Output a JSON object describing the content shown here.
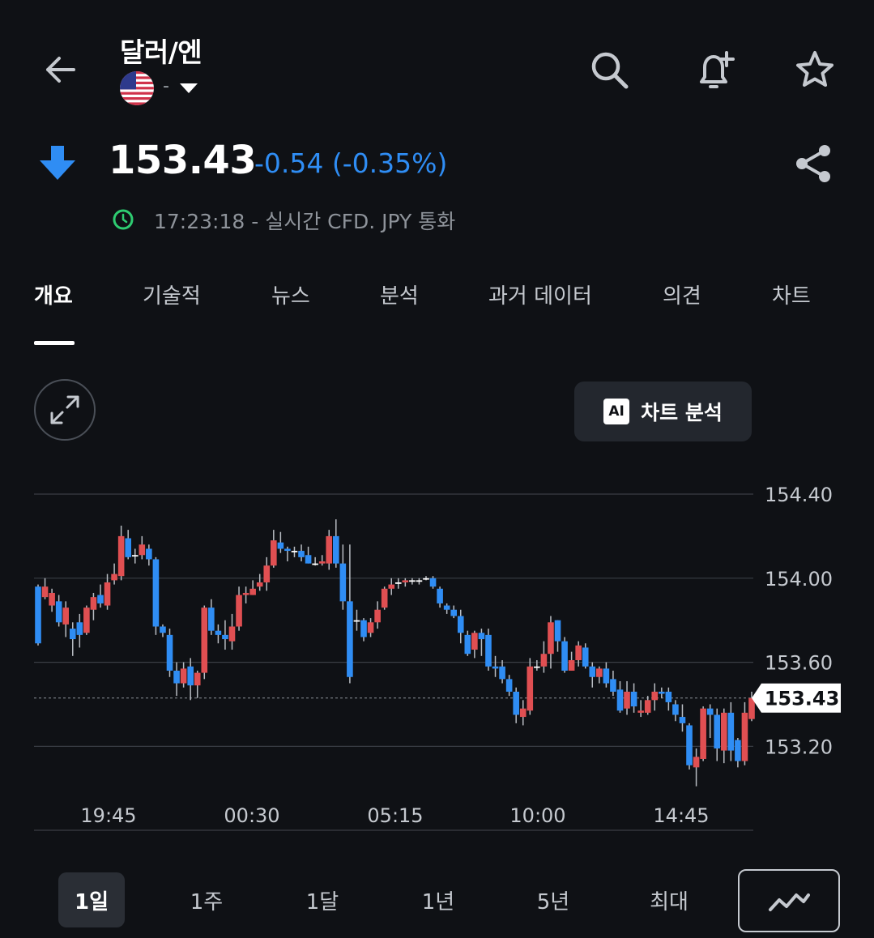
{
  "header": {
    "title": "달러/엔",
    "subtitle": "-",
    "back_icon": "arrow-left-icon",
    "search_icon": "search-icon",
    "alert_icon": "bell-plus-icon",
    "favorite_icon": "star-icon"
  },
  "quote": {
    "direction_icon": "arrow-down-icon",
    "price": "153.43",
    "change": "-0.54 (-0.35%)",
    "time_info": "17:23:18 - 실시간 CFD. JPY 통화",
    "share_icon": "share-icon"
  },
  "tabs": [
    {
      "label": "개요",
      "active": true
    },
    {
      "label": "기술적"
    },
    {
      "label": "뉴스"
    },
    {
      "label": "분석"
    },
    {
      "label": "과거 데이터"
    },
    {
      "label": "의견"
    },
    {
      "label": "차트"
    }
  ],
  "toolbar": {
    "expand_icon": "expand-icon",
    "ai_badge": "AI",
    "ai_button_label": "차트 분석"
  },
  "colors": {
    "up": "#e04f52",
    "down": "#2f8df4",
    "change_text": "#2f8df4",
    "clock": "#2ecc71",
    "background": "#0f1115"
  },
  "chart_data": {
    "type": "candlestick",
    "ylim": [
      153.0,
      154.45
    ],
    "y_ticks": [
      "154.40",
      "154.00",
      "153.60",
      "153.20"
    ],
    "x_ticks": [
      "19:45",
      "00:30",
      "05:15",
      "10:00",
      "14:45"
    ],
    "current_price_label": "153.43",
    "current_price": 153.43,
    "candles": [
      [
        153.96,
        153.69,
        153.97,
        153.68
      ],
      [
        153.91,
        153.96,
        154.0,
        153.9
      ],
      [
        153.87,
        153.93,
        153.95,
        153.84
      ],
      [
        153.89,
        153.79,
        153.92,
        153.77
      ],
      [
        153.78,
        153.86,
        153.89,
        153.72
      ],
      [
        153.76,
        153.71,
        153.79,
        153.63
      ],
      [
        153.79,
        153.73,
        153.83,
        153.67
      ],
      [
        153.74,
        153.86,
        153.87,
        153.73
      ],
      [
        153.85,
        153.91,
        153.93,
        153.8
      ],
      [
        153.92,
        153.88,
        153.97,
        153.86
      ],
      [
        153.87,
        153.98,
        154.02,
        153.85
      ],
      [
        153.99,
        154.02,
        154.07,
        153.97
      ],
      [
        154.01,
        154.2,
        154.25,
        153.99
      ],
      [
        154.19,
        154.1,
        154.23,
        154.09
      ],
      [
        154.11,
        154.11,
        154.14,
        154.07
      ],
      [
        154.11,
        154.16,
        154.2,
        154.09
      ],
      [
        154.14,
        154.09,
        154.16,
        154.06
      ],
      [
        154.09,
        153.77,
        154.1,
        153.73
      ],
      [
        153.77,
        153.74,
        153.78,
        153.72
      ],
      [
        153.73,
        153.56,
        153.76,
        153.53
      ],
      [
        153.56,
        153.5,
        153.6,
        153.44
      ],
      [
        153.5,
        153.57,
        153.6,
        153.48
      ],
      [
        153.58,
        153.49,
        153.62,
        153.42
      ],
      [
        153.49,
        153.55,
        153.56,
        153.43
      ],
      [
        153.55,
        153.86,
        153.87,
        153.52
      ],
      [
        153.86,
        153.75,
        153.9,
        153.73
      ],
      [
        153.75,
        153.73,
        153.78,
        153.69
      ],
      [
        153.73,
        153.71,
        153.8,
        153.66
      ],
      [
        153.7,
        153.77,
        153.83,
        153.66
      ],
      [
        153.77,
        153.92,
        153.96,
        153.75
      ],
      [
        153.92,
        153.93,
        153.96,
        153.88
      ],
      [
        153.92,
        153.95,
        153.99,
        153.92
      ],
      [
        153.96,
        153.98,
        154.02,
        153.94
      ],
      [
        153.98,
        154.06,
        154.1,
        153.94
      ],
      [
        154.06,
        154.18,
        154.23,
        154.05
      ],
      [
        154.17,
        154.14,
        154.22,
        154.12
      ],
      [
        154.14,
        154.13,
        154.15,
        154.08
      ],
      [
        154.13,
        154.13,
        154.15,
        154.1
      ],
      [
        154.13,
        154.1,
        154.16,
        154.08
      ],
      [
        154.11,
        154.07,
        154.15,
        154.07
      ],
      [
        154.07,
        154.07,
        154.1,
        154.06
      ],
      [
        154.07,
        154.08,
        154.11,
        154.06
      ],
      [
        154.07,
        154.2,
        154.23,
        154.04
      ],
      [
        154.2,
        154.07,
        154.28,
        154.05
      ],
      [
        154.07,
        153.89,
        154.16,
        153.85
      ],
      [
        153.89,
        153.53,
        154.16,
        153.5
      ],
      [
        153.8,
        153.8,
        153.85,
        153.75
      ],
      [
        153.8,
        153.72,
        153.81,
        153.7
      ],
      [
        153.74,
        153.79,
        153.81,
        153.72
      ],
      [
        153.79,
        153.85,
        153.89,
        153.76
      ],
      [
        153.86,
        153.95,
        153.96,
        153.85
      ],
      [
        153.95,
        153.97,
        154.0,
        153.92
      ],
      [
        153.98,
        153.98,
        154.0,
        153.95
      ],
      [
        153.98,
        153.99,
        154.0,
        153.96
      ],
      [
        153.99,
        153.99,
        154.0,
        153.97
      ],
      [
        153.99,
        153.99,
        154.0,
        153.97
      ],
      [
        154.0,
        154.0,
        154.01,
        153.99
      ],
      [
        154.0,
        153.96,
        154.01,
        153.95
      ],
      [
        153.95,
        153.88,
        153.96,
        153.86
      ],
      [
        153.87,
        153.85,
        153.88,
        153.83
      ],
      [
        153.85,
        153.82,
        153.87,
        153.81
      ],
      [
        153.82,
        153.74,
        153.85,
        153.69
      ],
      [
        153.73,
        153.64,
        153.75,
        153.63
      ],
      [
        153.66,
        153.74,
        153.75,
        153.62
      ],
      [
        153.74,
        153.71,
        153.76,
        153.63
      ],
      [
        153.73,
        153.58,
        153.76,
        153.56
      ],
      [
        153.58,
        153.57,
        153.63,
        153.53
      ],
      [
        153.58,
        153.52,
        153.61,
        153.5
      ],
      [
        153.52,
        153.46,
        153.54,
        153.44
      ],
      [
        153.46,
        153.35,
        153.48,
        153.31
      ],
      [
        153.34,
        153.38,
        153.42,
        153.3
      ],
      [
        153.37,
        153.58,
        153.62,
        153.35
      ],
      [
        153.58,
        153.58,
        153.61,
        153.56
      ],
      [
        153.58,
        153.64,
        153.7,
        153.55
      ],
      [
        153.64,
        153.79,
        153.82,
        153.57
      ],
      [
        153.8,
        153.7,
        153.8,
        153.65
      ],
      [
        153.7,
        153.56,
        153.72,
        153.55
      ],
      [
        153.56,
        153.61,
        153.65,
        153.56
      ],
      [
        153.61,
        153.68,
        153.7,
        153.58
      ],
      [
        153.67,
        153.58,
        153.69,
        153.57
      ],
      [
        153.58,
        153.53,
        153.6,
        153.48
      ],
      [
        153.53,
        153.57,
        153.58,
        153.5
      ],
      [
        153.57,
        153.5,
        153.6,
        153.48
      ],
      [
        153.52,
        153.46,
        153.56,
        153.44
      ],
      [
        153.47,
        153.37,
        153.51,
        153.36
      ],
      [
        153.38,
        153.46,
        153.51,
        153.35
      ],
      [
        153.46,
        153.39,
        153.5,
        153.36
      ],
      [
        153.36,
        153.37,
        153.42,
        153.34
      ],
      [
        153.36,
        153.42,
        153.44,
        153.35
      ],
      [
        153.42,
        153.46,
        153.5,
        153.37
      ],
      [
        153.46,
        153.45,
        153.48,
        153.43
      ],
      [
        153.46,
        153.41,
        153.48,
        153.37
      ],
      [
        153.4,
        153.35,
        153.42,
        153.32
      ],
      [
        153.34,
        153.31,
        153.4,
        153.27
      ],
      [
        153.3,
        153.11,
        153.31,
        153.09
      ],
      [
        153.1,
        153.15,
        153.19,
        153.01
      ],
      [
        153.14,
        153.38,
        153.39,
        153.13
      ],
      [
        153.38,
        153.35,
        153.4,
        153.24
      ],
      [
        153.35,
        153.19,
        153.38,
        153.13
      ],
      [
        153.18,
        153.36,
        153.38,
        153.12
      ],
      [
        153.36,
        153.18,
        153.41,
        153.13
      ],
      [
        153.23,
        153.13,
        153.24,
        153.1
      ],
      [
        153.13,
        153.36,
        153.41,
        153.11
      ],
      [
        153.33,
        153.43,
        153.46,
        153.32
      ]
    ]
  },
  "periods": [
    {
      "label": "1일",
      "active": true
    },
    {
      "label": "1주"
    },
    {
      "label": "1달"
    },
    {
      "label": "1년"
    },
    {
      "label": "5년"
    },
    {
      "label": "최대"
    }
  ],
  "chart_type_icon": "line-chart-icon"
}
